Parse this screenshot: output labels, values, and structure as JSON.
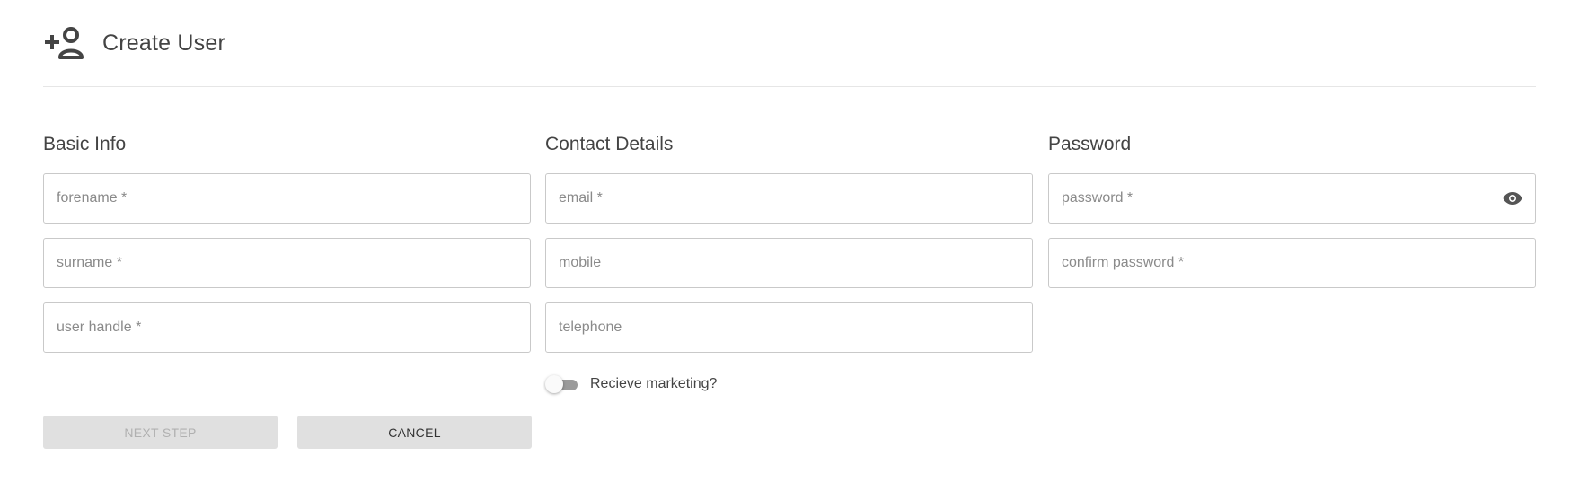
{
  "header": {
    "title": "Create User",
    "icon": "person-add-icon"
  },
  "basic_info": {
    "title": "Basic Info",
    "forename_placeholder": "forename *",
    "surname_placeholder": "surname *",
    "handle_placeholder": "user handle *"
  },
  "contact": {
    "title": "Contact Details",
    "email_placeholder": "email *",
    "mobile_placeholder": "mobile",
    "telephone_placeholder": "telephone",
    "marketing_label": "Recieve marketing?",
    "marketing_enabled": false
  },
  "password": {
    "title": "Password",
    "password_placeholder": "password *",
    "confirm_placeholder": "confirm password *",
    "visibility_icon": "eye-icon"
  },
  "actions": {
    "next_label": "NEXT STEP",
    "next_disabled": true,
    "cancel_label": "CANCEL"
  },
  "colors": {
    "border": "#c9c9c9",
    "button_bg": "#e0e0e0",
    "toggle_track": "#9b9b9b"
  }
}
